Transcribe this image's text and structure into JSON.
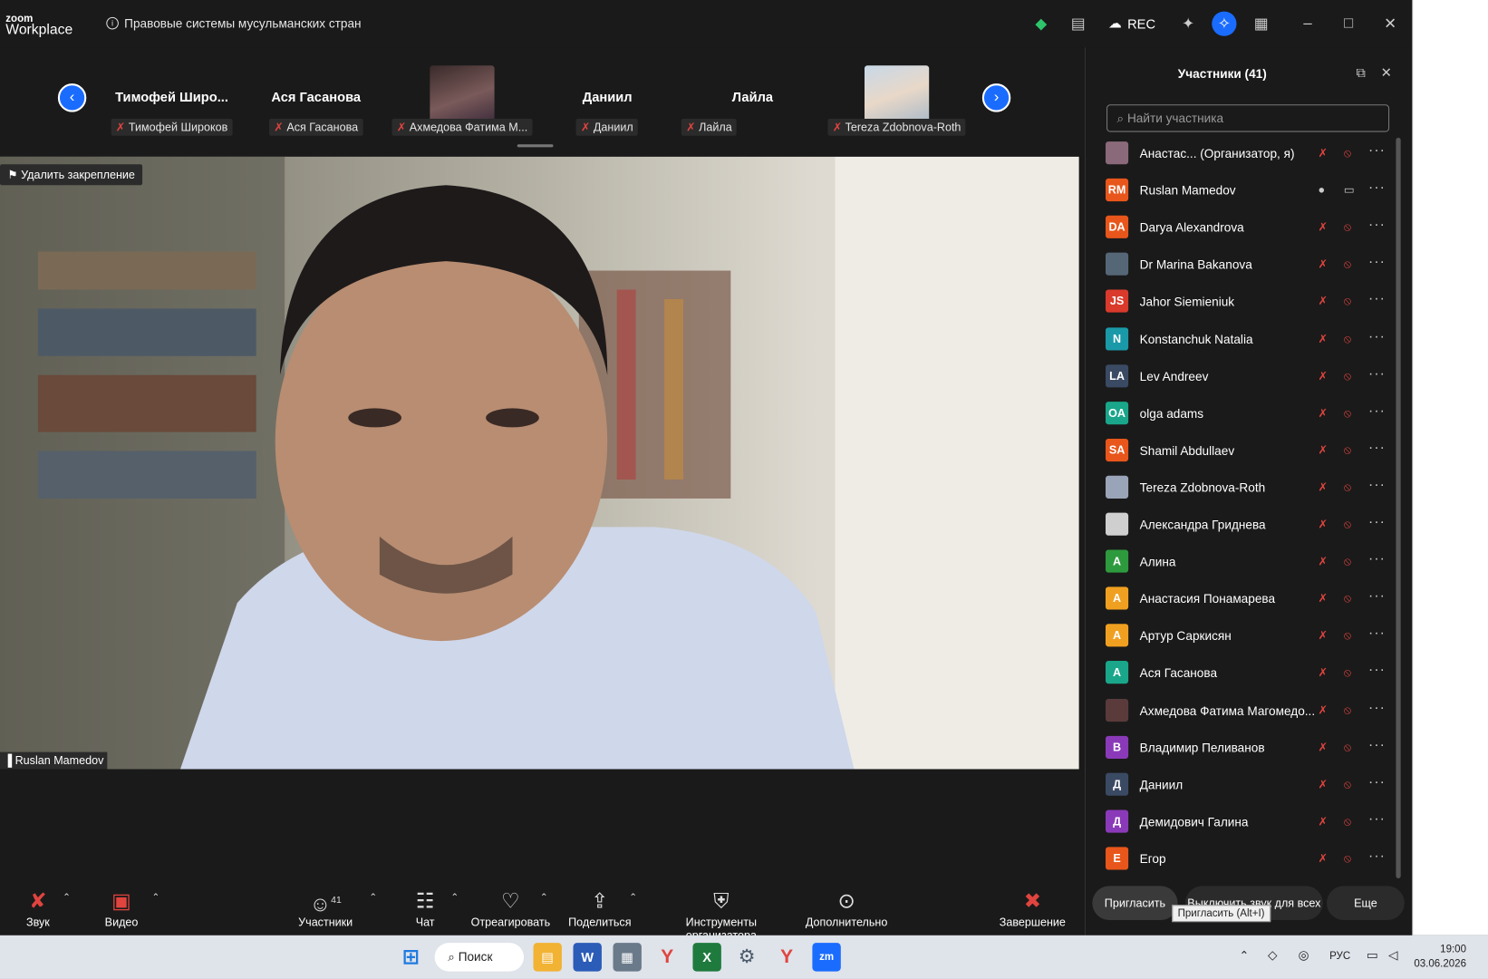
{
  "app": {
    "brand_top": "zoom",
    "brand_bottom": "Workplace",
    "meeting_title": "Правовые системы мусульманских стран",
    "rec_label": "REC"
  },
  "strip": {
    "tiles": [
      {
        "name": "Тимофей Широ...",
        "label": "Тимофей Широков"
      },
      {
        "name": "Ася Гасанова",
        "label": "Ася Гасанова"
      },
      {
        "name": "",
        "label": "Ахмедова Фатима М..."
      },
      {
        "name": "Даниил",
        "label": "Даниил"
      },
      {
        "name": "Лайла",
        "label": "Лайла"
      },
      {
        "name": "",
        "label": "Tereza Zdobnova-Roth"
      }
    ]
  },
  "video": {
    "unpin_label": "Удалить закрепление",
    "speaker_name": "Ruslan Mamedov"
  },
  "panel": {
    "title": "Участники (41)",
    "search_placeholder": "Найти участника",
    "participants": [
      {
        "initials": "",
        "name": "Анастас... (Организатор, я)",
        "color": "#8a6a7a"
      },
      {
        "initials": "RM",
        "name": "Ruslan Mamedov",
        "color": "#e8561b"
      },
      {
        "initials": "DA",
        "name": "Darya Alexandrova",
        "color": "#e8561b"
      },
      {
        "initials": "",
        "name": "Dr Marina Bakanova",
        "color": "#556677"
      },
      {
        "initials": "JS",
        "name": "Jahor Siemieniuk",
        "color": "#d93a2b"
      },
      {
        "initials": "N",
        "name": "Konstanchuk Natalia",
        "color": "#1a9aa8"
      },
      {
        "initials": "LA",
        "name": "Lev Andreev",
        "color": "#3b4a63"
      },
      {
        "initials": "OA",
        "name": "olga adams",
        "color": "#1aa68a"
      },
      {
        "initials": "SA",
        "name": "Shamil Abdullaev",
        "color": "#e8561b"
      },
      {
        "initials": "",
        "name": "Tereza Zdobnova-Roth",
        "color": "#9aa4b8"
      },
      {
        "initials": "",
        "name": "Александра Гриднева",
        "color": "#cfcfcf"
      },
      {
        "initials": "A",
        "name": "Алина",
        "color": "#2e9a3e"
      },
      {
        "initials": "A",
        "name": "Анастасия Понамарева",
        "color": "#f0a020"
      },
      {
        "initials": "A",
        "name": "Артур Саркисян",
        "color": "#f0a020"
      },
      {
        "initials": "A",
        "name": "Ася Гасанова",
        "color": "#1aa68a"
      },
      {
        "initials": "",
        "name": "Ахмедова Фатима Магомедо...",
        "color": "#5a3a3a"
      },
      {
        "initials": "B",
        "name": "Владимир Пеливанов",
        "color": "#8a3ab8"
      },
      {
        "initials": "Д",
        "name": "Даниил",
        "color": "#3b4a63"
      },
      {
        "initials": "Д",
        "name": "Демидович Галина",
        "color": "#8a3ab8"
      },
      {
        "initials": "E",
        "name": "Егор",
        "color": "#e8561b"
      }
    ],
    "invite_label": "Пригласить",
    "mute_all_label": "Выключить звук для всех",
    "more_label": "Еще",
    "tooltip": "Пригласить (Alt+I)"
  },
  "toolbar": {
    "audio": "Звук",
    "video": "Видео",
    "participants": "Участники",
    "participants_count": "41",
    "chat": "Чат",
    "react": "Отреагировать",
    "share": "Поделиться",
    "host_tools": "Инструменты организатора",
    "more": "Дополнительно",
    "end": "Завершение"
  },
  "taskbar": {
    "search": "Поиск",
    "lang": "РУС",
    "time": "19:00",
    "date": "03.06.2026"
  }
}
